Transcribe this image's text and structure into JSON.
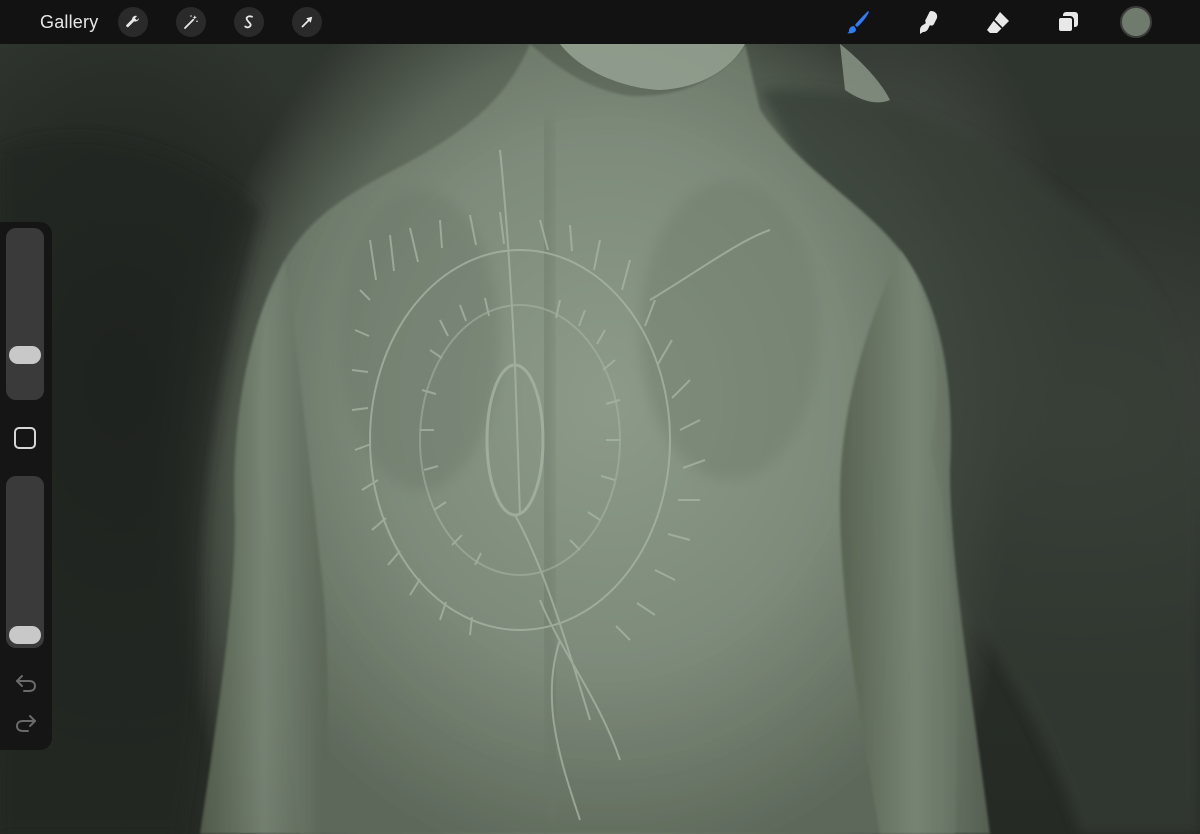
{
  "topbar": {
    "gallery_label": "Gallery",
    "left_tools": [
      {
        "name": "wrench-icon",
        "purpose": "actions"
      },
      {
        "name": "magic-wand-icon",
        "purpose": "adjustments"
      },
      {
        "name": "selection-s-icon",
        "purpose": "selection"
      },
      {
        "name": "arrow-cursor-icon",
        "purpose": "transform"
      }
    ],
    "right_tools": [
      {
        "name": "brush-icon",
        "active": true,
        "color": "#2f7df6"
      },
      {
        "name": "smudge-icon",
        "active": false
      },
      {
        "name": "eraser-icon",
        "active": false
      },
      {
        "name": "layers-icon",
        "active": false
      }
    ],
    "current_color": "#6f7b6c"
  },
  "sidebar": {
    "brush_size_level": 0.22,
    "brush_opacity_level": 0.0,
    "controls": [
      "brush-size-slider",
      "modify-button",
      "brush-opacity-slider",
      "undo-button",
      "redo-button"
    ]
  },
  "canvas": {
    "subject": "painting",
    "palette": {
      "background_dark": "#2a2f29",
      "skin_light": "#8c9989",
      "skin_mid": "#7d8a7a",
      "shadow": "#4f594d"
    }
  }
}
